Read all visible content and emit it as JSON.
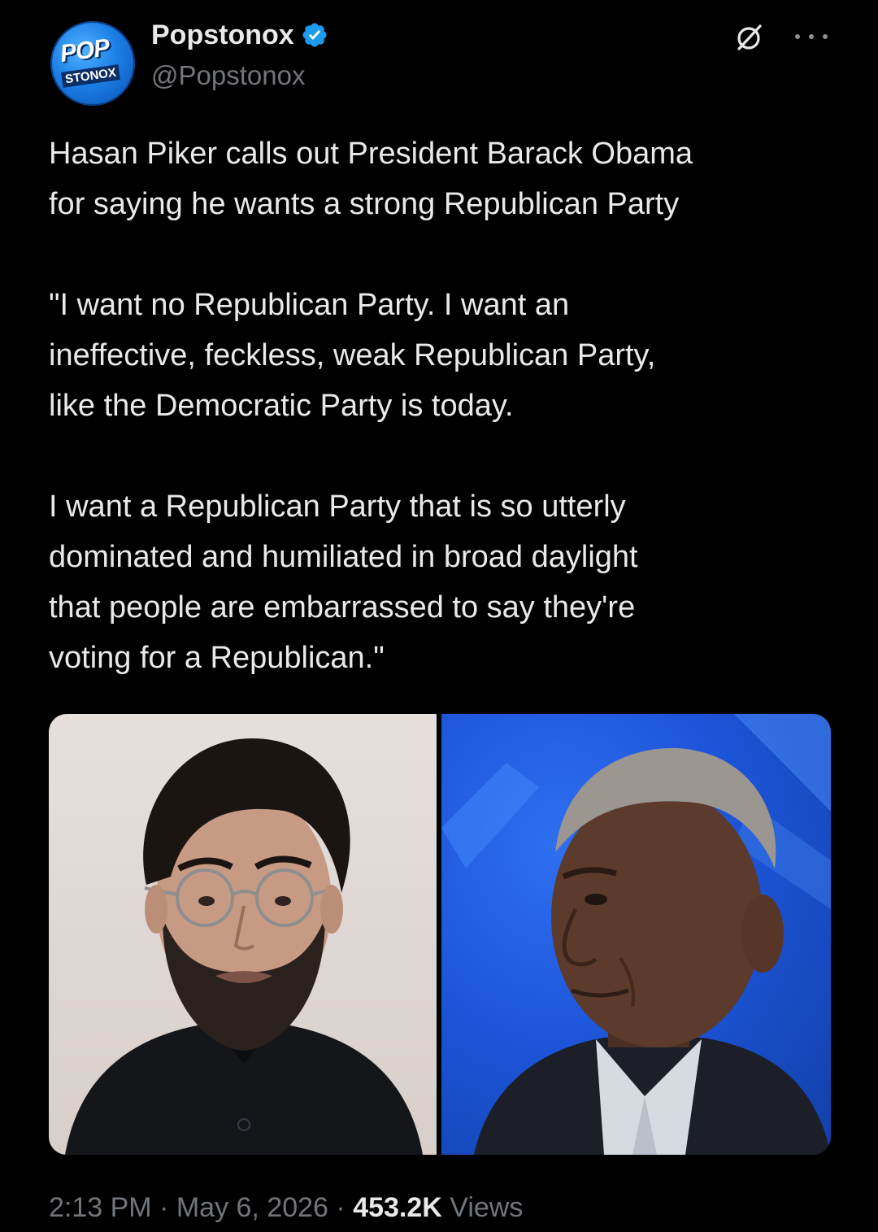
{
  "author": {
    "display_name": "Popstonox",
    "handle": "@Popstonox",
    "verified": true,
    "avatar_logo": {
      "line1": "POP",
      "line2": "STONOX"
    }
  },
  "header_actions": {
    "grok_icon": "grok-slash-icon",
    "more_icon": "more-horizontal-icon"
  },
  "tweet": {
    "paragraphs": [
      "Hasan Piker calls out President Barack Obama\nfor saying he wants a strong Republican Party",
      "\"I want no Republican Party. I want an\nineffective, feckless, weak Republican Party,\nlike the Democratic Party is today.",
      "I want a Republican Party that is so utterly\ndominated and humiliated in broad daylight\nthat people are embarrassed to say they're\nvoting for a Republican.\""
    ]
  },
  "media": {
    "photos": [
      {
        "subject": "left-portrait",
        "background_color": "#ddd5d2"
      },
      {
        "subject": "right-portrait",
        "background_color": "#1d55d9"
      }
    ]
  },
  "meta": {
    "time": "2:13 PM",
    "separator": " · ",
    "date": "May 6, 2026",
    "views_count": "453.2K",
    "views_label": "Views"
  },
  "colors": {
    "background": "#000000",
    "primary_text": "#e7e9ea",
    "secondary_text": "#71767b",
    "verified_blue": "#1d9bf0"
  }
}
